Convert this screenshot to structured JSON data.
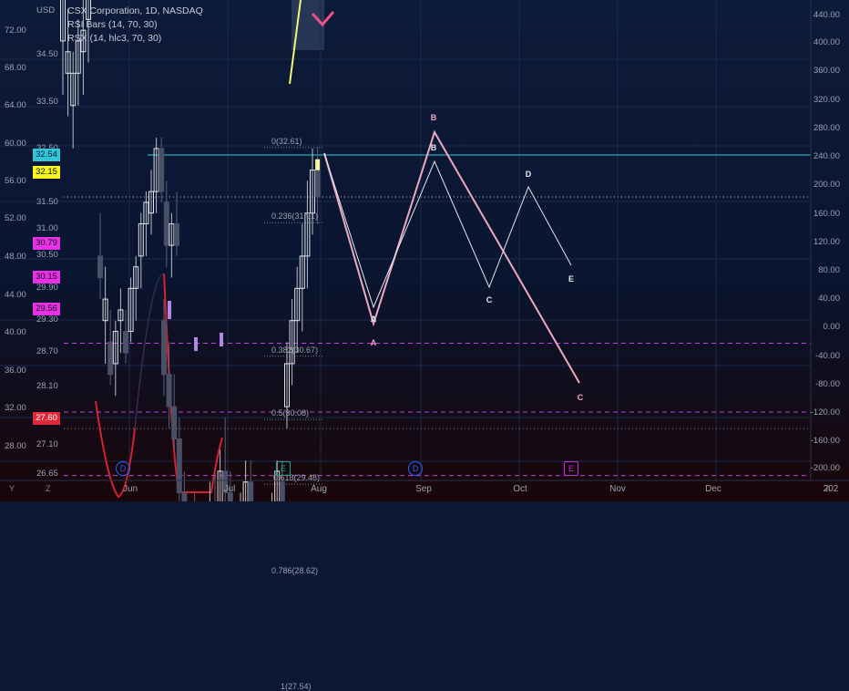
{
  "header": {
    "title": "CSX Corporation, 1D, NASDAQ",
    "indicator1": "RSI Bars (14, 70, 30)",
    "indicator2": "RSX (14, hlc3, 70, 30)",
    "currency": "USD"
  },
  "colors": {
    "background_top": "#0b1733",
    "background_bottom": "#14070a",
    "up_candle": "#e4e4ea",
    "down_candle": "#4a5066",
    "pivot_cyan": "#30c8d8",
    "support_red": "#d8324a",
    "magenta_dash": "#c040e0",
    "pattern_pink": "#f0a8c0",
    "pattern_white": "#e8e8f0",
    "rsx_line": "#d82030"
  },
  "chart_data": {
    "type": "candlestick",
    "symbol": "CSX",
    "interval": "1D",
    "exchange": "NASDAQ",
    "x_labels": [
      "Jun",
      "Jul",
      "Aug",
      "Sep",
      "Oct",
      "Nov",
      "Dec",
      "202"
    ],
    "price_axis_left": [
      "34.50",
      "33.50",
      "32.50",
      "31.50",
      "31.00",
      "30.50",
      "29.90",
      "29.30",
      "28.70",
      "28.10",
      "27.10",
      "26.65"
    ],
    "price_axis_center": [
      "72.00",
      "68.00",
      "64.00",
      "60.00",
      "56.00",
      "52.00",
      "48.00",
      "44.00",
      "40.00",
      "36.00",
      "32.00",
      "28.00"
    ],
    "price_axis_right": [
      "440.00",
      "400.00",
      "360.00",
      "320.00",
      "280.00",
      "240.00",
      "200.00",
      "160.00",
      "120.00",
      "80.00",
      "40.00",
      "0.00",
      "-40.00",
      "-80.00",
      "-120.00",
      "-160.00",
      "-200.00"
    ],
    "price_badges": [
      {
        "value": "32.54",
        "color": "#30c8d8",
        "text_color": "#0b1733"
      },
      {
        "value": "32.15",
        "color": "#f5f522",
        "text_color": "#111111"
      },
      {
        "value": "30.79",
        "color": "#e830e8",
        "text_color": "#111111"
      },
      {
        "value": "30.15",
        "color": "#e830e8",
        "text_color": "#111111"
      },
      {
        "value": "29.56",
        "color": "#e830e8",
        "text_color": "#111111"
      },
      {
        "value": "27.60",
        "color": "#e02838",
        "text_color": "#ffffff"
      }
    ],
    "levels": [
      {
        "name": "resistance",
        "value": 32.54
      },
      {
        "name": "last",
        "value": 32.15
      },
      {
        "name": "dash1",
        "value": 30.79
      },
      {
        "name": "dash2",
        "value": 30.15
      },
      {
        "name": "dash3",
        "value": 29.56
      },
      {
        "name": "support",
        "value": 27.6
      }
    ],
    "fib_levels": [
      {
        "label": "0(32.61)",
        "value": 32.61
      },
      {
        "label": "0.236(31.91)",
        "value": 31.91
      },
      {
        "label": "0.382(30.67)",
        "value": 30.67
      },
      {
        "label": "0.5(30.08)",
        "value": 30.08
      },
      {
        "label": "0.618(29.48)",
        "value": 29.48
      },
      {
        "label": "0.786(28.62)",
        "value": 28.62
      },
      {
        "label": "1(27.54)",
        "value": 27.54
      }
    ],
    "candles": [
      {
        "o": 33.6,
        "h": 34.25,
        "l": 33.1,
        "c": 34.0
      },
      {
        "o": 33.3,
        "h": 33.9,
        "l": 32.9,
        "c": 33.5
      },
      {
        "o": 33.0,
        "h": 33.5,
        "l": 32.6,
        "c": 33.3
      },
      {
        "o": 33.3,
        "h": 33.8,
        "l": 33.0,
        "c": 33.6
      },
      {
        "o": 33.5,
        "h": 34.0,
        "l": 33.1,
        "c": 33.7
      },
      {
        "o": 33.8,
        "h": 34.1,
        "l": 33.4,
        "c": 34.0
      },
      {
        "o": 31.6,
        "h": 32.0,
        "l": 31.2,
        "c": 31.4
      },
      {
        "o": 31.0,
        "h": 31.5,
        "l": 30.6,
        "c": 31.2
      },
      {
        "o": 30.8,
        "h": 31.1,
        "l": 30.4,
        "c": 30.5
      },
      {
        "o": 30.6,
        "h": 31.0,
        "l": 30.3,
        "c": 30.9
      },
      {
        "o": 31.0,
        "h": 31.3,
        "l": 30.7,
        "c": 31.1
      },
      {
        "o": 30.9,
        "h": 31.1,
        "l": 30.6,
        "c": 30.7
      },
      {
        "o": 30.9,
        "h": 31.4,
        "l": 30.8,
        "c": 31.3
      },
      {
        "o": 31.3,
        "h": 31.6,
        "l": 31.0,
        "c": 31.5
      },
      {
        "o": 31.6,
        "h": 32.0,
        "l": 31.3,
        "c": 31.9
      },
      {
        "o": 31.9,
        "h": 32.2,
        "l": 31.6,
        "c": 32.1
      },
      {
        "o": 32.0,
        "h": 32.4,
        "l": 31.8,
        "c": 32.2
      },
      {
        "o": 32.2,
        "h": 32.7,
        "l": 32.0,
        "c": 32.6
      },
      {
        "o": 32.6,
        "h": 32.7,
        "l": 32.1,
        "c": 32.2
      },
      {
        "o": 32.1,
        "h": 32.3,
        "l": 31.5,
        "c": 31.7
      },
      {
        "o": 31.7,
        "h": 32.0,
        "l": 31.4,
        "c": 31.9
      },
      {
        "o": 31.9,
        "h": 32.2,
        "l": 31.6,
        "c": 31.7
      },
      {
        "o": 31.0,
        "h": 31.2,
        "l": 30.3,
        "c": 30.5
      },
      {
        "o": 30.5,
        "h": 30.8,
        "l": 30.0,
        "c": 30.2
      },
      {
        "o": 30.2,
        "h": 30.5,
        "l": 29.8,
        "c": 29.9
      },
      {
        "o": 29.9,
        "h": 30.1,
        "l": 29.2,
        "c": 29.4
      },
      {
        "o": 29.4,
        "h": 29.6,
        "l": 28.8,
        "c": 29.0
      },
      {
        "o": 29.0,
        "h": 29.3,
        "l": 28.6,
        "c": 29.2
      },
      {
        "o": 29.1,
        "h": 29.4,
        "l": 28.8,
        "c": 29.0
      },
      {
        "o": 29.0,
        "h": 29.3,
        "l": 28.7,
        "c": 28.9
      },
      {
        "o": 28.9,
        "h": 29.1,
        "l": 28.5,
        "c": 28.8
      },
      {
        "o": 28.8,
        "h": 29.5,
        "l": 28.6,
        "c": 29.3
      },
      {
        "o": 29.3,
        "h": 29.6,
        "l": 29.0,
        "c": 29.1
      },
      {
        "o": 29.1,
        "h": 29.8,
        "l": 28.9,
        "c": 29.6
      },
      {
        "o": 29.6,
        "h": 30.1,
        "l": 29.2,
        "c": 29.4
      },
      {
        "o": 29.4,
        "h": 29.6,
        "l": 28.8,
        "c": 29.0
      },
      {
        "o": 29.0,
        "h": 29.2,
        "l": 28.5,
        "c": 28.7
      },
      {
        "o": 28.7,
        "h": 29.4,
        "l": 28.6,
        "c": 29.2
      },
      {
        "o": 29.2,
        "h": 29.7,
        "l": 29.0,
        "c": 29.5
      },
      {
        "o": 29.5,
        "h": 29.7,
        "l": 28.9,
        "c": 29.0
      },
      {
        "o": 29.0,
        "h": 29.2,
        "l": 28.5,
        "c": 28.7
      },
      {
        "o": 28.7,
        "h": 29.0,
        "l": 28.2,
        "c": 28.4
      },
      {
        "o": 28.4,
        "h": 28.6,
        "l": 27.8,
        "c": 28.0
      },
      {
        "o": 28.0,
        "h": 28.2,
        "l": 27.54,
        "c": 27.7
      },
      {
        "o": 28.6,
        "h": 28.9,
        "l": 28.3,
        "c": 28.7
      },
      {
        "o": 28.8,
        "h": 29.4,
        "l": 28.6,
        "c": 29.2
      },
      {
        "o": 29.2,
        "h": 29.7,
        "l": 29.0,
        "c": 29.6
      },
      {
        "o": 29.5,
        "h": 29.7,
        "l": 29.1,
        "c": 29.3
      },
      {
        "o": 30.2,
        "h": 30.8,
        "l": 30.0,
        "c": 30.6
      },
      {
        "o": 30.6,
        "h": 31.2,
        "l": 30.4,
        "c": 31.0
      },
      {
        "o": 31.0,
        "h": 31.5,
        "l": 30.7,
        "c": 31.3
      },
      {
        "o": 31.3,
        "h": 31.9,
        "l": 30.9,
        "c": 31.6
      },
      {
        "o": 31.6,
        "h": 32.3,
        "l": 31.3,
        "c": 32.0
      },
      {
        "o": 32.0,
        "h": 32.6,
        "l": 31.8,
        "c": 32.4
      },
      {
        "o": 32.4,
        "h": 32.61,
        "l": 31.9,
        "c": 32.15
      }
    ],
    "pattern_pink": {
      "labels": [
        "A",
        "B",
        "C"
      ],
      "points": [
        {
          "x": "Aug",
          "y": 29.2
        },
        {
          "x": "Sep",
          "y": 32.4
        },
        {
          "x": "Oct",
          "y": 28.0
        }
      ]
    },
    "pattern_white": {
      "labels": [
        "A",
        "B",
        "C",
        "D",
        "E"
      ],
      "points": [
        {
          "x": "Aug",
          "y": 29.6
        },
        {
          "x": "Sep",
          "y": 31.9
        },
        {
          "x": "Sep",
          "y": 30.0
        },
        {
          "x": "Oct",
          "y": 31.5
        },
        {
          "x": "Oct",
          "y": 30.4
        }
      ]
    },
    "events": [
      {
        "label": "D",
        "color": "#2962ff"
      },
      {
        "label": "E",
        "color": "#1fa39a"
      },
      {
        "label": "D",
        "color": "#2962ff"
      },
      {
        "label": "E",
        "color": "#c030e0"
      }
    ]
  },
  "corner": {
    "left": "Y",
    "mid": "Z",
    "right": "A"
  }
}
